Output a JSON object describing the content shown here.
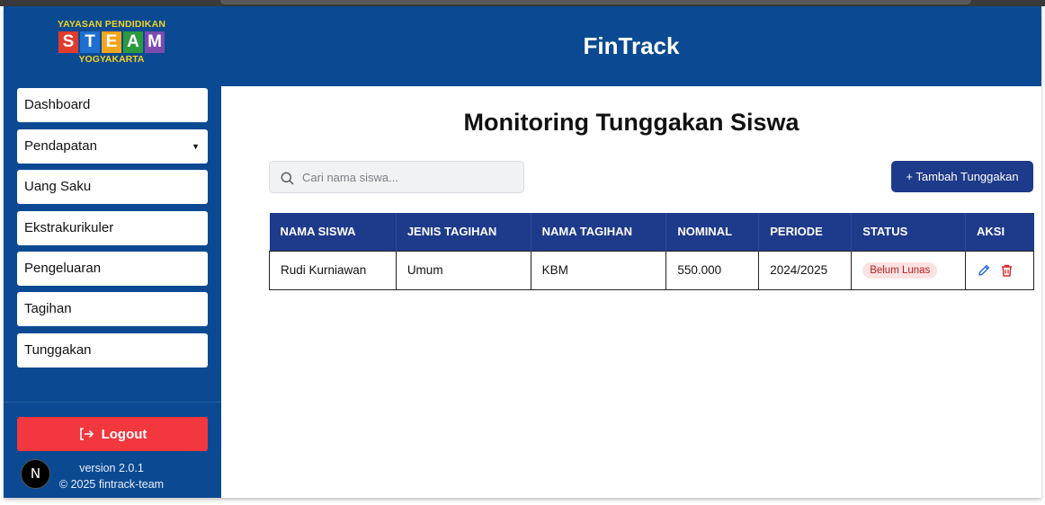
{
  "logo": {
    "line1": "YAYASAN PENDIDIKAN",
    "letters": [
      {
        "char": "S",
        "color": "#e23b2e"
      },
      {
        "char": "T",
        "color": "#1e6fd0"
      },
      {
        "char": "E",
        "color": "#f4a51c"
      },
      {
        "char": "A",
        "color": "#2c9a3f"
      },
      {
        "char": "M",
        "color": "#7c4bb0"
      }
    ],
    "line3": "YOGYAKARTA"
  },
  "header": {
    "app_title": "FinTrack"
  },
  "sidebar": {
    "items": [
      {
        "label": "Dashboard"
      },
      {
        "label": "Pendapatan",
        "caret": "▼"
      },
      {
        "label": "Uang Saku"
      },
      {
        "label": "Ekstrakurikuler"
      },
      {
        "label": "Pengeluaran"
      },
      {
        "label": "Tagihan"
      },
      {
        "label": "Tunggakan"
      }
    ],
    "logout_label": "Logout",
    "version": "version 2.0.1",
    "copyright": "© 2025 fintrack-team",
    "badge_letter": "N"
  },
  "main": {
    "title": "Monitoring Tunggakan Siswa",
    "search_placeholder": "Cari nama siswa...",
    "add_button_label": "+ Tambah Tunggakan",
    "table": {
      "headers": [
        "NAMA SISWA",
        "JENIS TAGIHAN",
        "NAMA TAGIHAN",
        "NOMINAL",
        "PERIODE",
        "STATUS",
        "AKSI"
      ],
      "rows": [
        {
          "nama_siswa": "Rudi Kurniawan",
          "jenis_tagihan": "Umum",
          "nama_tagihan": "KBM",
          "nominal": "550.000",
          "periode": "2024/2025",
          "status": "Belum Lunas"
        }
      ]
    }
  },
  "colors": {
    "primary": "#0b4a92",
    "table_header": "#1e3a8a",
    "logout": "#f2373f",
    "status_bg": "#fde2e2",
    "status_text": "#b91c1c",
    "edit_icon": "#2563eb",
    "delete_icon": "#dc2626"
  },
  "icons": [
    "search-icon",
    "logout-icon",
    "edit-icon",
    "trash-icon",
    "caret-down-icon"
  ]
}
